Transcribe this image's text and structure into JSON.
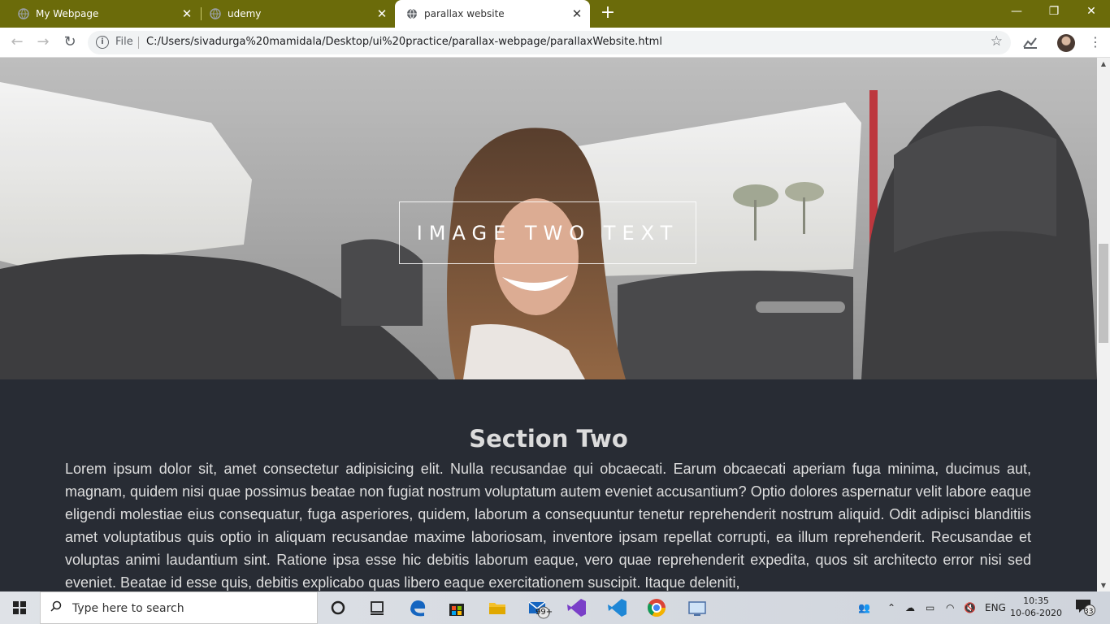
{
  "browser": {
    "tabs": [
      {
        "title": "My Webpage",
        "active": false
      },
      {
        "title": "udemy",
        "active": false
      },
      {
        "title": "parallax website",
        "active": true
      }
    ],
    "new_tab_symbol": "+",
    "window_controls": {
      "minimize": "—",
      "restore": "❐",
      "close": "✕"
    },
    "nav": {
      "back": "←",
      "forward": "→",
      "reload": "↻"
    },
    "address": {
      "scheme_label": "File",
      "url": "C:/Users/sivadurga%20mamidala/Desktop/ui%20practice/parallax-webpage/parallaxWebsite.html"
    },
    "bookmark_star": "☆",
    "menu": "⋮"
  },
  "page": {
    "hero_text": "IMAGE TWO TEXT",
    "section": {
      "title": "Section Two",
      "body": "Lorem ipsum dolor sit, amet consectetur adipisicing elit. Nulla recusandae qui obcaecati. Earum obcaecati aperiam fuga minima, ducimus aut, magnam, quidem nisi quae possimus beatae non fugiat nostrum voluptatum autem eveniet accusantium? Optio dolores aspernatur velit labore eaque eligendi molestiae eius consequatur, fuga asperiores, quidem, laborum a consequuntur tenetur reprehenderit nostrum aliquid. Odit adipisci blanditiis amet voluptatibus quis optio in aliquam recusandae maxime laboriosam, inventore ipsam repellat corrupti, ea illum reprehenderit. Recusandae et voluptas animi laudantium sint. Ratione ipsa esse hic debitis laborum eaque, vero quae reprehenderit expedita, quos sit architecto error nisi sed eveniet. Beatae id esse quis, debitis explicabo quas libero eaque exercitationem suscipit. Itaque deleniti,"
    }
  },
  "taskbar": {
    "search_placeholder": "Type here to search",
    "mail_badge": "99+",
    "tray_language": "ENG",
    "clock_time": "10:35",
    "clock_date": "10-06-2020",
    "notification_count": "33"
  },
  "colors": {
    "tabstrip": "#6b6b0a",
    "page_background": "#282c34",
    "section_text": "#dedede"
  }
}
